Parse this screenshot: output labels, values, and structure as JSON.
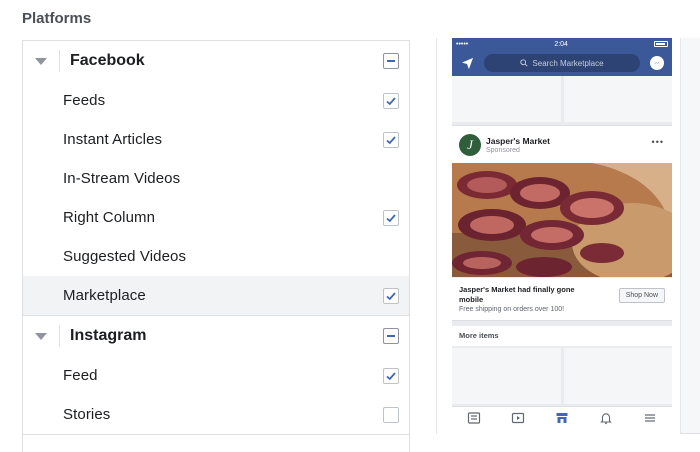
{
  "section_title": "Platforms",
  "platforms": {
    "facebook": {
      "label": "Facebook",
      "items": [
        {
          "label": "Feeds",
          "checked": true
        },
        {
          "label": "Instant Articles",
          "checked": true
        },
        {
          "label": "In-Stream Videos",
          "checked": false
        },
        {
          "label": "Right Column",
          "checked": true
        },
        {
          "label": "Suggested Videos",
          "checked": false
        },
        {
          "label": "Marketplace",
          "checked": true
        }
      ]
    },
    "instagram": {
      "label": "Instagram",
      "items": [
        {
          "label": "Feed",
          "checked": true
        },
        {
          "label": "Stories",
          "checked": false
        }
      ]
    }
  },
  "preview": {
    "status_time": "2:04",
    "search_placeholder": "Search Marketplace",
    "ad": {
      "avatar_letter": "J",
      "advertiser": "Jasper's Market",
      "sponsored": "Sponsored",
      "more": "•••",
      "headline": "Jasper's Market had finally gone mobile",
      "subline": "Free shipping on orders over 100!",
      "cta": "Shop Now"
    },
    "more_items": "More items"
  },
  "colors": {
    "accent": "#4267b2",
    "nav_blue": "#3b5998",
    "selected_row": "#f2f3f5"
  },
  "icons": [
    "caret-down-icon",
    "checkmark-icon",
    "minus-icon",
    "send-icon",
    "search-icon",
    "messenger-icon",
    "news-feed-icon",
    "video-icon",
    "marketplace-icon",
    "bell-icon",
    "menu-icon"
  ]
}
